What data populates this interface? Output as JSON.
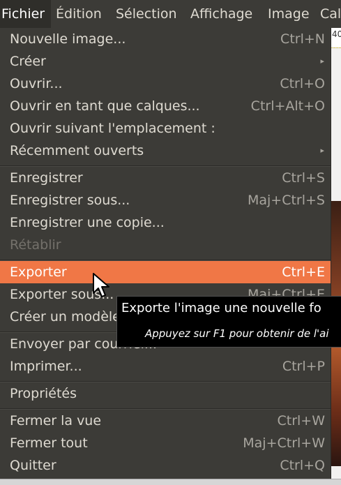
{
  "menubar": {
    "items": [
      "Fichier",
      "Édition",
      "Sélection",
      "Affichage",
      "Image",
      "Cal"
    ]
  },
  "background": {
    "ruler_number": "40"
  },
  "menu": {
    "items": [
      {
        "label": "Nouvelle image...",
        "accel": "Ctrl+N"
      },
      {
        "label": "Créer",
        "submenu": true
      },
      {
        "label": "Ouvrir...",
        "accel": "Ctrl+O"
      },
      {
        "label": "Ouvrir en tant que calques...",
        "accel": "Ctrl+Alt+O"
      },
      {
        "label": "Ouvrir suivant l'emplacement :",
        "accel": ""
      },
      {
        "label": "Récemment ouverts",
        "submenu": true
      },
      {
        "label": "Enregistrer",
        "accel": "Ctrl+S"
      },
      {
        "label": "Enregistrer sous...",
        "accel": "Maj+Ctrl+S"
      },
      {
        "label": "Enregistrer une copie...",
        "accel": ""
      },
      {
        "label": "Rétablir",
        "accel": "",
        "disabled": true
      },
      {
        "label": "Exporter",
        "accel": "Ctrl+E",
        "highlighted": true
      },
      {
        "label": "Exporter sous...",
        "accel": "Maj+Ctrl+E"
      },
      {
        "label": "Créer un modèle...",
        "accel": ""
      },
      {
        "label": "Envoyer par courriel...",
        "accel": ""
      },
      {
        "label": "Imprimer...",
        "accel": "Ctrl+P"
      },
      {
        "label": "Propriétés",
        "accel": ""
      },
      {
        "label": "Fermer la vue",
        "accel": "Ctrl+W"
      },
      {
        "label": "Fermer tout",
        "accel": "Maj+Ctrl+W"
      },
      {
        "label": "Quitter",
        "accel": "Ctrl+Q"
      }
    ]
  },
  "tooltip": {
    "title": "Exporte l'image une nouvelle fo",
    "hint": "Appuyez sur F1 pour obtenir de l'ai"
  },
  "icons": {
    "submenu": "submenu-arrow-icon",
    "cursor": "mouse-pointer-icon"
  },
  "colors": {
    "menu_bg": "#3c3b37",
    "highlight": "#f07746",
    "tooltip_bg": "#000000"
  }
}
